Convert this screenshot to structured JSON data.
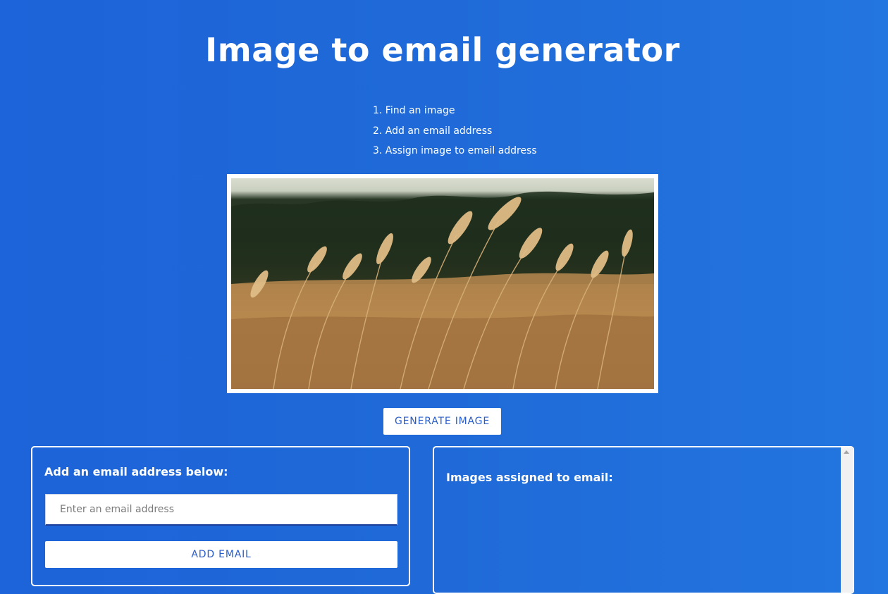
{
  "header": {
    "title": "Image to email generator"
  },
  "steps": [
    "1. Find an image",
    "2. Add an email address",
    "3. Assign image to email address"
  ],
  "generate_button": {
    "label": "GENERATE IMAGE"
  },
  "email_panel": {
    "heading": "Add an email address below:",
    "input_placeholder": "Enter an email address",
    "input_value": "",
    "add_button_label": "ADD EMAIL"
  },
  "assigned_panel": {
    "heading": "Images assigned to email:"
  },
  "colors": {
    "background": "#1f6ad8",
    "button_text": "#2a5dc9",
    "panel_border": "#ffffff"
  },
  "icons": {
    "scroll_up": "scroll-up-arrow-icon"
  }
}
